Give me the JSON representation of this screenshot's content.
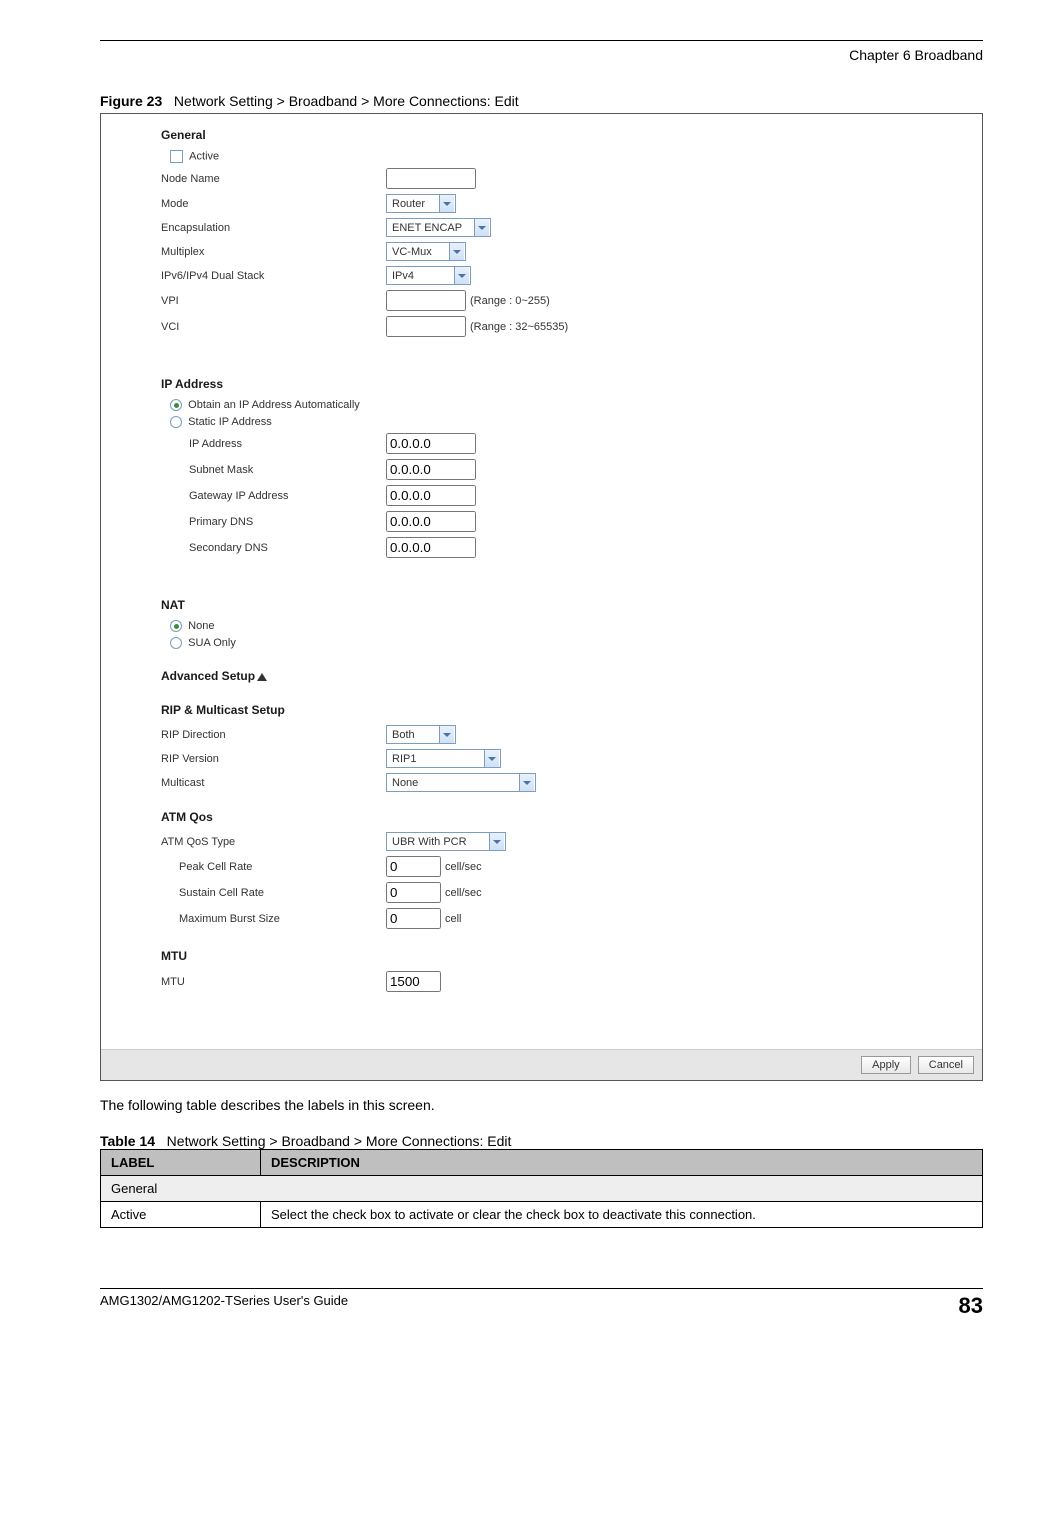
{
  "header": {
    "chapter": "Chapter 6 Broadband"
  },
  "figure": {
    "num": "Figure 23",
    "title": "Network Setting > Broadband > More Connections: Edit"
  },
  "general": {
    "head": "General",
    "active_lbl": "Active",
    "node_name_lbl": "Node Name",
    "node_name_val": "",
    "mode_lbl": "Mode",
    "mode_val": "Router",
    "encap_lbl": "Encapsulation",
    "encap_val": "ENET ENCAP",
    "mux_lbl": "Multiplex",
    "mux_val": "VC-Mux",
    "dual_lbl": "IPv6/IPv4 Dual Stack",
    "dual_val": "IPv4",
    "vpi_lbl": "VPI",
    "vpi_val": "",
    "vpi_range": "(Range : 0~255)",
    "vci_lbl": "VCI",
    "vci_val": "",
    "vci_range": "(Range : 32~65535)"
  },
  "ip": {
    "head": "IP Address",
    "auto_lbl": "Obtain an IP Address Automatically",
    "static_lbl": "Static IP Address",
    "addr_lbl": "IP Address",
    "mask_lbl": "Subnet Mask",
    "gw_lbl": "Gateway IP Address",
    "dns1_lbl": "Primary DNS",
    "dns2_lbl": "Secondary DNS",
    "placeholder": "0.0.0.0"
  },
  "nat": {
    "head": "NAT",
    "none_lbl": "None",
    "sua_lbl": "SUA Only"
  },
  "adv": {
    "head": "Advanced Setup"
  },
  "rip": {
    "head": "RIP & Multicast Setup",
    "dir_lbl": "RIP Direction",
    "dir_val": "Both",
    "ver_lbl": "RIP Version",
    "ver_val": "RIP1",
    "mc_lbl": "Multicast",
    "mc_val": "None"
  },
  "atm": {
    "head": "ATM Qos",
    "type_lbl": "ATM QoS Type",
    "type_val": "UBR With PCR",
    "pcr_lbl": "Peak Cell Rate",
    "pcr_val": "0",
    "pcr_suf": "cell/sec",
    "scr_lbl": "Sustain Cell Rate",
    "scr_val": "0",
    "scr_suf": "cell/sec",
    "mbs_lbl": "Maximum Burst Size",
    "mbs_val": "0",
    "mbs_suf": "cell"
  },
  "mtu": {
    "head": "MTU",
    "lbl": "MTU",
    "val": "1500"
  },
  "buttons": {
    "apply": "Apply",
    "cancel": "Cancel"
  },
  "para": "The following table describes the labels in this screen.",
  "table": {
    "num": "Table 14",
    "title": "Network Setting > Broadband > More Connections: Edit",
    "h_label": "LABEL",
    "h_desc": "DESCRIPTION",
    "rows": [
      {
        "label": "General",
        "desc": ""
      },
      {
        "label": "Active",
        "desc": "Select the check box to activate or clear the check box to deactivate this connection."
      }
    ]
  },
  "footer": {
    "guide": "AMG1302/AMG1202-TSeries User's Guide",
    "page": "83"
  }
}
